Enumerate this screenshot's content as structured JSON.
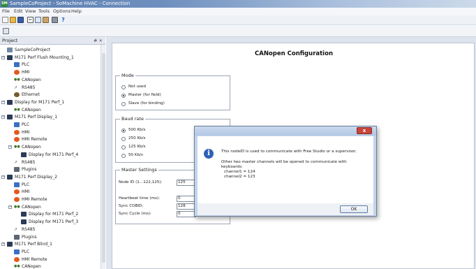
{
  "window": {
    "title": "SampleCoProject - SoMachine HVAC - Connection",
    "app_icon": "SM"
  },
  "menu": [
    "File",
    "Edit",
    "View",
    "Tools",
    "Options",
    "Help"
  ],
  "toolbar_icons": [
    "new-icon",
    "open-icon",
    "save-icon",
    "cut-icon",
    "copy-icon",
    "paste-icon",
    "print-icon",
    "help-icon"
  ],
  "panel": {
    "title": "Project",
    "buttons": "# ×",
    "tree": [
      {
        "label": "SampleCoProject",
        "level": 0,
        "icon": "project",
        "toggle": ""
      },
      {
        "label": "M171 Perf Flush Mounting_1",
        "level": 0,
        "icon": "device",
        "toggle": "−"
      },
      {
        "label": "PLC",
        "level": 1,
        "icon": "plc",
        "toggle": ""
      },
      {
        "label": "HMI",
        "level": 1,
        "icon": "hmi",
        "toggle": ""
      },
      {
        "label": "CANopen",
        "level": 1,
        "icon": "bus",
        "toggle": ""
      },
      {
        "label": "RS485",
        "level": 1,
        "icon": "rs",
        "toggle": ""
      },
      {
        "label": "Ethernet",
        "level": 1,
        "icon": "eth",
        "toggle": ""
      },
      {
        "label": "Display for M171 Perf_1",
        "level": 0,
        "icon": "device",
        "toggle": "−"
      },
      {
        "label": "CANopen",
        "level": 1,
        "icon": "bus",
        "toggle": ""
      },
      {
        "label": "M171 Perf Display_1",
        "level": 0,
        "icon": "device",
        "toggle": "−"
      },
      {
        "label": "PLC",
        "level": 1,
        "icon": "plc",
        "toggle": ""
      },
      {
        "label": "HMI",
        "level": 1,
        "icon": "hmi",
        "toggle": ""
      },
      {
        "label": "HMI Remote",
        "level": 1,
        "icon": "hmi",
        "toggle": ""
      },
      {
        "label": "CANopen",
        "level": 1,
        "icon": "bus",
        "toggle": "−"
      },
      {
        "label": "Display for M171 Perf_4",
        "level": 2,
        "icon": "device",
        "toggle": ""
      },
      {
        "label": "RS485",
        "level": 1,
        "icon": "rs",
        "toggle": ""
      },
      {
        "label": "Plugins",
        "level": 1,
        "icon": "plugin",
        "toggle": ""
      },
      {
        "label": "M171 Perf Display_2",
        "level": 0,
        "icon": "device",
        "toggle": "−"
      },
      {
        "label": "PLC",
        "level": 1,
        "icon": "plc",
        "toggle": ""
      },
      {
        "label": "HMI",
        "level": 1,
        "icon": "hmi",
        "toggle": ""
      },
      {
        "label": "HMI Remote",
        "level": 1,
        "icon": "hmi",
        "toggle": ""
      },
      {
        "label": "CANopen",
        "level": 1,
        "icon": "bus",
        "toggle": "−"
      },
      {
        "label": "Display for M171 Perf_2",
        "level": 2,
        "icon": "device",
        "toggle": ""
      },
      {
        "label": "Display for M171 Perf_3",
        "level": 2,
        "icon": "device",
        "toggle": ""
      },
      {
        "label": "RS485",
        "level": 1,
        "icon": "rs",
        "toggle": ""
      },
      {
        "label": "Plugins",
        "level": 1,
        "icon": "plugin",
        "toggle": ""
      },
      {
        "label": "M171 Perf Blind_1",
        "level": 0,
        "icon": "device",
        "toggle": "−"
      },
      {
        "label": "PLC",
        "level": 1,
        "icon": "plc",
        "toggle": ""
      },
      {
        "label": "HMI Remote",
        "level": 1,
        "icon": "hmi",
        "toggle": ""
      },
      {
        "label": "CANopen",
        "level": 1,
        "icon": "bus",
        "toggle": ""
      }
    ]
  },
  "config": {
    "title": "CANopen Configuration",
    "mode": {
      "label": "Mode",
      "options": [
        {
          "text": "Not used",
          "selected": false
        },
        {
          "text": "Master (for field)",
          "selected": true
        },
        {
          "text": "Slave (for binding)",
          "selected": false
        }
      ]
    },
    "baud": {
      "label": "Baud rate",
      "options": [
        {
          "text": "500 Kb/s",
          "selected": true
        },
        {
          "text": "250 Kb/s",
          "selected": false
        },
        {
          "text": "125 Kb/s",
          "selected": false
        },
        {
          "text": "50 Kb/s",
          "selected": false
        }
      ]
    },
    "master": {
      "label": "Master Settings",
      "fields": [
        {
          "label": "Node ID (1...122,125):",
          "value": "125"
        },
        {
          "label": "Heartbeat time (ms):",
          "value": "0"
        },
        {
          "label": "Sync COBID:",
          "value": "128"
        },
        {
          "label": "Sync Cycle (ms):",
          "value": "0"
        }
      ]
    }
  },
  "dialog": {
    "title": "",
    "close_label": "x",
    "icon": "info-icon",
    "line1": "This nodeID is used to communicate with Free Studio or a supervisor.",
    "line2": "Other two master channels will be opened to communicate with",
    "line3": "keyboards:",
    "line4": "channel1 = 124",
    "line5": "channel2 = 123",
    "ok_label": "OK"
  },
  "colors": {
    "title_bar": "#5c7fb0",
    "accent_info": "#2f62b5",
    "close_button": "#c8453a"
  }
}
